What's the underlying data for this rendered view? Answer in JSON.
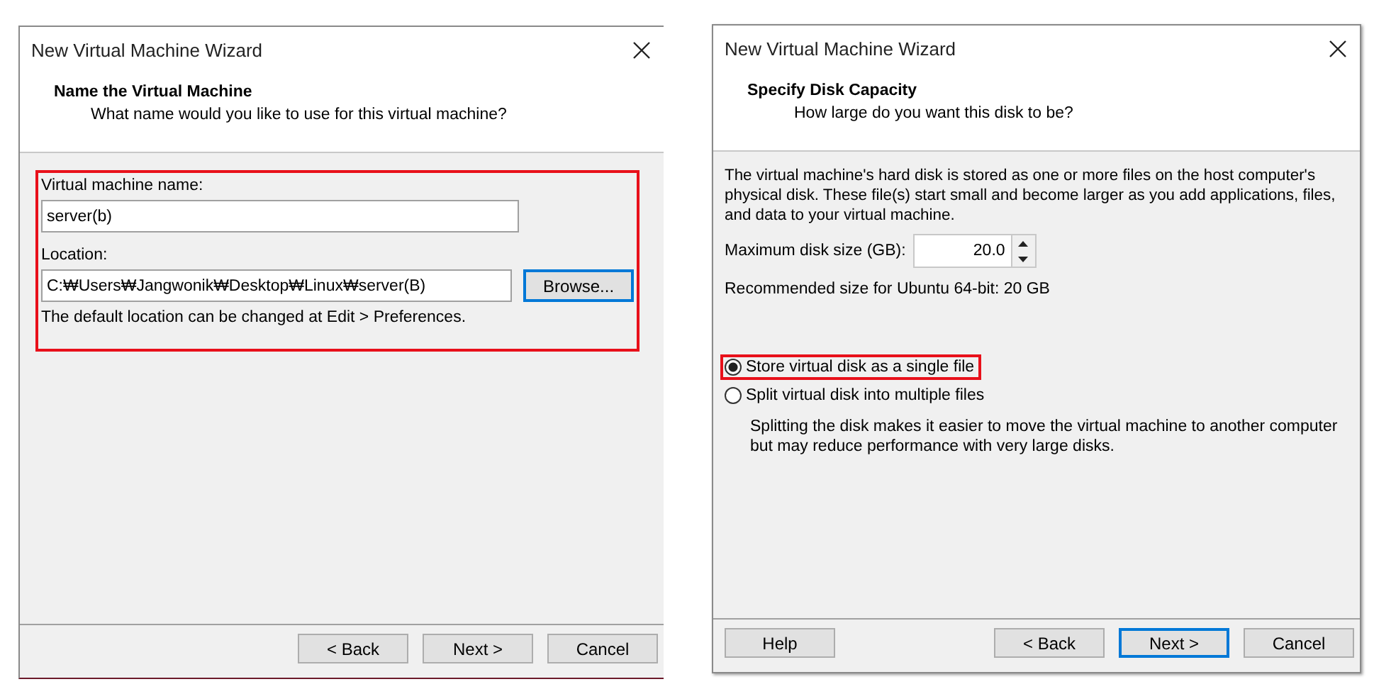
{
  "name_dialog": {
    "title": "New Virtual Machine Wizard",
    "heading": "Name the Virtual Machine",
    "subheading": "What name would you like to use for this virtual machine?",
    "form": {
      "highlighted": true,
      "name_label": "Virtual machine name:",
      "name_value": "server(b)",
      "location_label": "Location:",
      "location_value": "C:₩Users₩Jangwonik₩Desktop₩Linux₩server(B)",
      "browse_button": {
        "label": "Browse...",
        "default": true
      },
      "note": "The default location can be changed at Edit > Preferences."
    },
    "buttons": [
      {
        "label": "< Back",
        "default": false
      },
      {
        "label": "Next >",
        "default": false
      },
      {
        "label": "Cancel",
        "default": false
      }
    ]
  },
  "disk_dialog": {
    "title": "New Virtual Machine Wizard",
    "heading": "Specify Disk Capacity",
    "subheading": "How large do you want this disk to be?",
    "description": "The virtual machine's hard disk is stored as one or more files on the host computer's physical disk. These file(s) start small and become larger as you add applications, files, and data to your virtual machine.",
    "size_label": "Maximum disk size (GB):",
    "size_value": "20.0",
    "recommended": "Recommended size for Ubuntu 64-bit: 20 GB",
    "options": [
      {
        "label": "Store virtual disk as a single file",
        "selected": true,
        "highlighted": true
      },
      {
        "label": "Split virtual disk into multiple files",
        "selected": false,
        "highlighted": false,
        "note": "Splitting the disk makes it easier to move the virtual machine to another computer but may reduce performance with very large disks."
      }
    ],
    "help_button": {
      "label": "Help",
      "default": false
    },
    "buttons": [
      {
        "label": "< Back",
        "default": false
      },
      {
        "label": "Next >",
        "default": true
      },
      {
        "label": "Cancel",
        "default": false
      }
    ]
  }
}
